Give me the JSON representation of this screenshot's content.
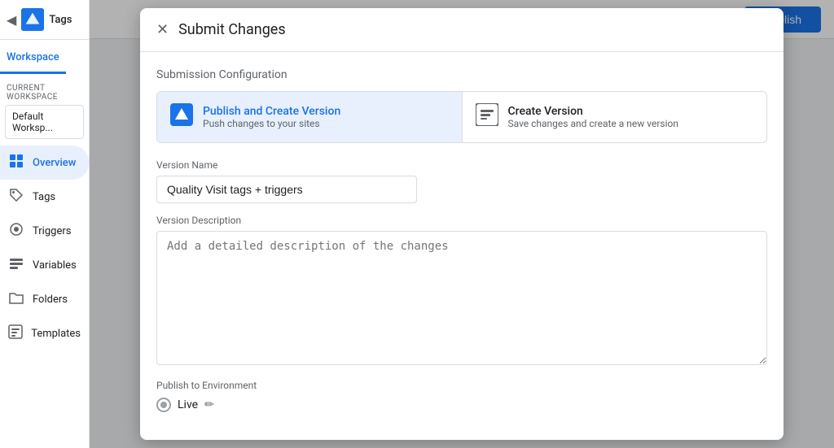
{
  "app": {
    "title": "Tags",
    "back_icon": "◀",
    "logo_alt": "GTM Logo"
  },
  "sidebar": {
    "workspace_tab": "Workspace",
    "current_workspace_label": "CURRENT WORKSPACE",
    "workspace_name": "Default Worksp...",
    "nav_items": [
      {
        "id": "overview",
        "label": "Overview",
        "icon": "⬛",
        "active": true
      },
      {
        "id": "tags",
        "label": "Tags",
        "icon": "🏷"
      },
      {
        "id": "triggers",
        "label": "Triggers",
        "icon": "⚙"
      },
      {
        "id": "variables",
        "label": "Variables",
        "icon": "⬛"
      },
      {
        "id": "folders",
        "label": "Folders",
        "icon": "📁"
      },
      {
        "id": "templates",
        "label": "Templates",
        "icon": "⬛"
      }
    ]
  },
  "topbar": {
    "publish_label": "Publish"
  },
  "dialog": {
    "title": "Submit Changes",
    "close_icon": "✕",
    "submission_config_label": "Submission Configuration",
    "options": [
      {
        "id": "publish-create",
        "title": "Publish and Create Version",
        "subtitle": "Push changes to your sites",
        "selected": true
      },
      {
        "id": "create-version",
        "title": "Create Version",
        "subtitle": "Save changes and create a new version",
        "selected": false
      }
    ],
    "version_name_label": "Version Name",
    "version_name_value": "Quality Visit tags + triggers",
    "version_desc_label": "Version Description",
    "version_desc_placeholder": "Add a detailed description of the changes",
    "publish_env_label": "Publish to Environment",
    "env_live_label": "Live",
    "edit_icon": "✏"
  },
  "arrow": {
    "color": "#0a8a0a"
  }
}
